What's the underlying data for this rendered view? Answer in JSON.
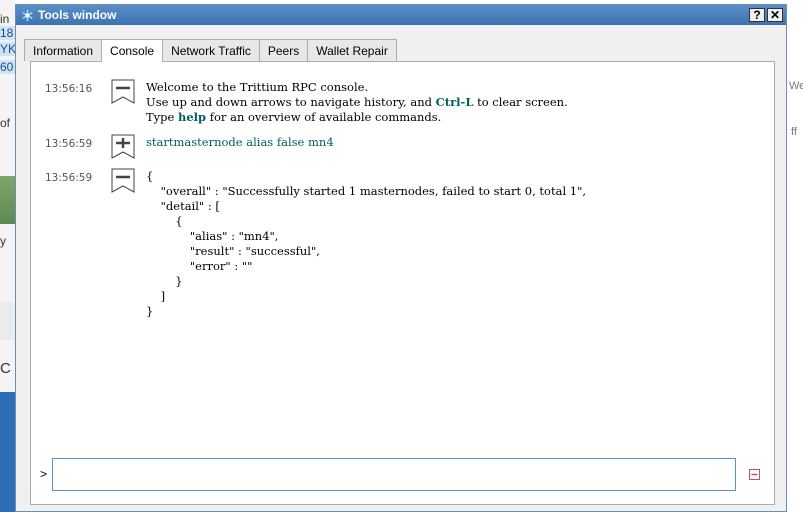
{
  "background": {
    "left_fragments": [
      "in",
      "18",
      "YK",
      "60",
      "of",
      "y",
      "C"
    ],
    "right_fragments": [
      "We",
      "ff"
    ]
  },
  "window": {
    "title": "Tools window",
    "help_button": "?",
    "close_button": "✕"
  },
  "tabs": [
    {
      "label": "Information",
      "active": false
    },
    {
      "label": "Console",
      "active": true
    },
    {
      "label": "Network Traffic",
      "active": false
    },
    {
      "label": "Peers",
      "active": false
    },
    {
      "label": "Wallet Repair",
      "active": false
    }
  ],
  "console": {
    "entries": [
      {
        "time": "13:56:16",
        "kind": "reply",
        "lines": [
          "Welcome to the Trittium RPC console.",
          "Use up and down arrows to navigate history, and Ctrl-L to clear screen.",
          "Type help for an overview of available commands."
        ]
      },
      {
        "time": "13:56:59",
        "kind": "command",
        "text": "startmasternode alias false mn4"
      },
      {
        "time": "13:56:59",
        "kind": "reply",
        "lines": [
          "{",
          "    \"overall\" : \"Successfully started 1 masternodes, failed to start 0, total 1\",",
          "    \"detail\" : [",
          "        {",
          "            \"alias\" : \"mn4\",",
          "            \"result\" : \"successful\",",
          "            \"error\" : \"\"",
          "        }",
          "    ]",
          "}"
        ]
      }
    ],
    "prompt": ">",
    "input_value": ""
  },
  "icons": {
    "title": "trittium-logo-icon",
    "reply": "reply-tx-icon",
    "command": "command-tx-icon",
    "clear": "clear-console-icon"
  },
  "colors": {
    "title_bar": "#3d73b2",
    "highlight_keyword": "#006060",
    "input_border": "#5a8fc8"
  }
}
